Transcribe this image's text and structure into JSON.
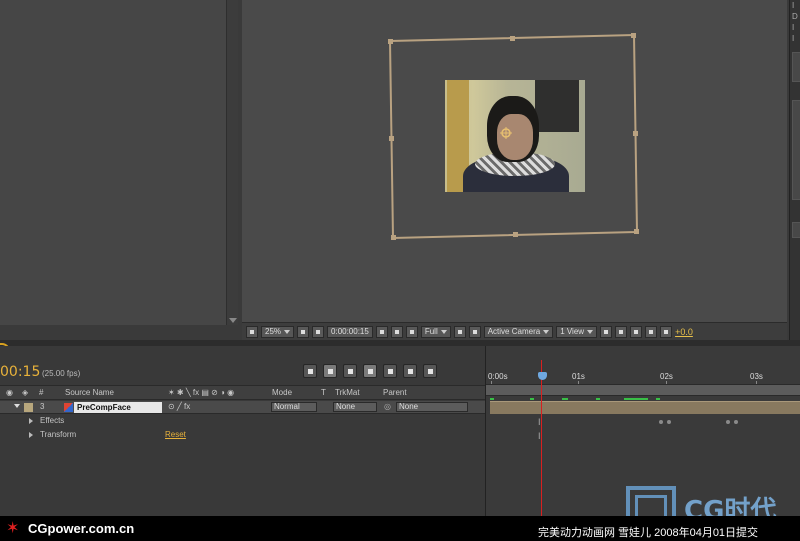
{
  "viewer": {
    "zoom": "25%",
    "timecode": "0:00:00:15",
    "resolution": "Full",
    "camera": "Active Camera",
    "views": "1 View",
    "exposure": "+0.0"
  },
  "right_strip": [
    "I",
    "D",
    "I",
    "I"
  ],
  "timeline": {
    "timecode": "00:15",
    "fps": "(25.00 fps)",
    "columns": {
      "number": "#",
      "source_name": "Source Name",
      "mode": "Mode",
      "t": "T",
      "trkmat": "TrkMat",
      "parent": "Parent"
    },
    "layer": {
      "number": "3",
      "name": "PreCompFace",
      "mode": "Normal",
      "trkmat": "None",
      "parent": "None"
    },
    "sub_rows": [
      {
        "label": "Effects"
      },
      {
        "label": "Transform",
        "action": "Reset"
      }
    ],
    "ruler": [
      "0:00s",
      "01s",
      "02s",
      "03s"
    ]
  },
  "banner": {
    "site": "CGpower.com.cn",
    "credit": "完美动力动画网 雪娃儿 2008年04月01日提交",
    "watermark": "CG时代"
  },
  "colors": {
    "timecode_accent": "#e8b23a",
    "playhead": "#d82020",
    "cache_bar": "#39c047",
    "camera_frame": "#b9a281"
  }
}
